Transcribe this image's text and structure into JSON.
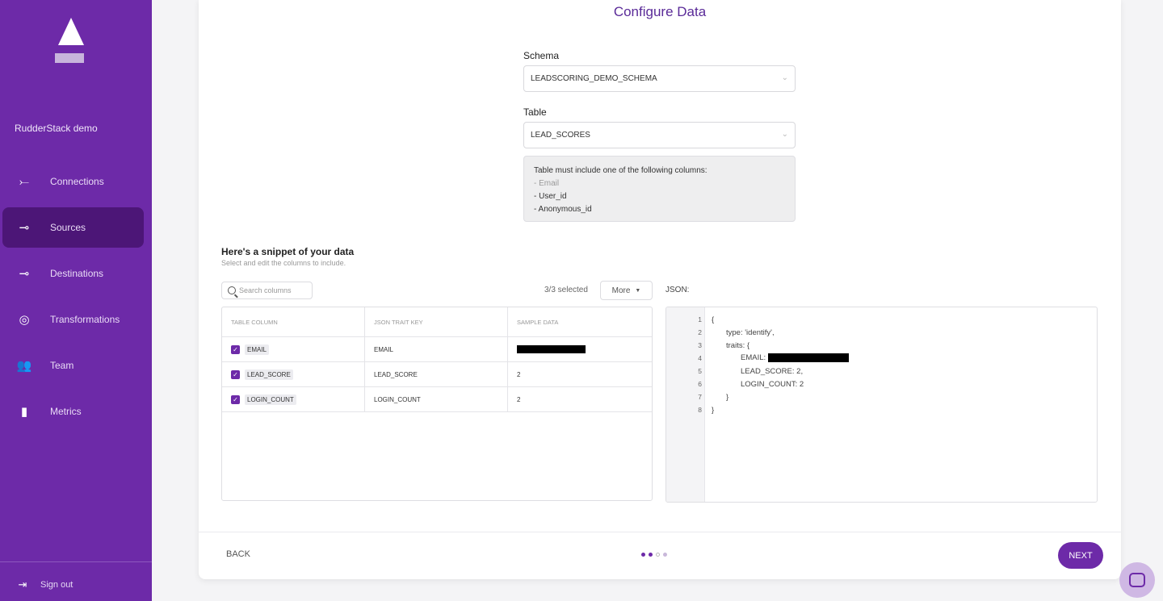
{
  "sidebar": {
    "workspace_name": "RudderStack demo",
    "items": [
      {
        "label": "Connections",
        "icon": "connections-icon",
        "glyph": "⤚"
      },
      {
        "label": "Sources",
        "icon": "sources-icon",
        "glyph": "⊸"
      },
      {
        "label": "Destinations",
        "icon": "destinations-icon",
        "glyph": "⊸"
      },
      {
        "label": "Transformations",
        "icon": "transformations-icon",
        "glyph": "◎"
      },
      {
        "label": "Team",
        "icon": "team-icon",
        "glyph": "👥"
      },
      {
        "label": "Metrics",
        "icon": "metrics-icon",
        "glyph": "▮"
      }
    ],
    "active_item": "Sources",
    "signout_label": "Sign out"
  },
  "main": {
    "title": "Configure Data",
    "schema": {
      "label": "Schema",
      "value": "LEADSCORING_DEMO_SCHEMA"
    },
    "table": {
      "label": "Table",
      "value": "LEAD_SCORES"
    },
    "info": {
      "heading": "Table must include one of the following columns:",
      "lines": [
        "- Email",
        "- User_id",
        "- Anonymous_id"
      ]
    },
    "snippet": {
      "title": "Here's a snippet of your data",
      "subtitle": "Select and edit the columns to include.",
      "search_placeholder": "Search columns",
      "selected_count": "3/3 selected",
      "more_label": "More",
      "columns": [
        "TABLE COLUMN",
        "JSON TRAIT KEY",
        "SAMPLE DATA"
      ],
      "rows": [
        {
          "column": "EMAIL",
          "trait": "EMAIL",
          "sample": "",
          "redacted": true
        },
        {
          "column": "LEAD_SCORE",
          "trait": "LEAD_SCORE",
          "sample": "2",
          "redacted": false
        },
        {
          "column": "LOGIN_COUNT",
          "trait": "LOGIN_COUNT",
          "sample": "2",
          "redacted": false
        }
      ]
    },
    "json": {
      "label": "JSON:",
      "lines": [
        {
          "n": "1",
          "text": "{"
        },
        {
          "n": "2",
          "text": "type: 'identify',"
        },
        {
          "n": "3",
          "text": "traits: {"
        },
        {
          "n": "4",
          "text": "EMAIL: "
        },
        {
          "n": "5",
          "text": "LEAD_SCORE: 2,"
        },
        {
          "n": "6",
          "text": "LOGIN_COUNT: 2"
        },
        {
          "n": "7",
          "text": "}"
        },
        {
          "n": "8",
          "text": "}"
        }
      ]
    },
    "footer": {
      "back_label": "BACK",
      "next_label": "NEXT",
      "step_current": 2,
      "step_total": 4
    }
  },
  "colors": {
    "brand": "#6d2aa8",
    "brand_dark": "#4c1677"
  }
}
